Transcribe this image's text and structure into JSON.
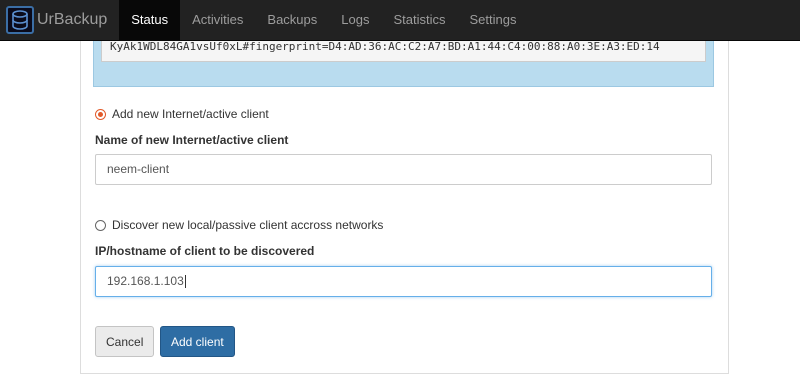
{
  "app": {
    "brand_name": "UrBackup",
    "logo_icon": "database-icon"
  },
  "nav": {
    "items": [
      {
        "label": "Status",
        "active": true
      },
      {
        "label": "Activities",
        "active": false
      },
      {
        "label": "Backups",
        "active": false
      },
      {
        "label": "Logs",
        "active": false
      },
      {
        "label": "Statistics",
        "active": false
      },
      {
        "label": "Settings",
        "active": false
      }
    ]
  },
  "info_box": {
    "code_text": "KyAk1WDL84GA1vsUf0xL#fingerprint=D4:AD:36:AC:C2:A7:BD:A1:44:C4:00:88:A0:3E:A3:ED:14"
  },
  "internet_client": {
    "radio_label": "Add new Internet/active client",
    "selected": true,
    "name_label": "Name of new Internet/active client",
    "name_value": "neem-client"
  },
  "local_client": {
    "radio_label": "Discover new local/passive client accross networks",
    "selected": false,
    "host_label": "IP/hostname of client to be discovered",
    "host_value": "192.168.1.103"
  },
  "actions": {
    "cancel_label": "Cancel",
    "add_label": "Add client"
  },
  "colors": {
    "navbar": "#222222",
    "accent": "#2e6da4",
    "radio_selected": "#e25a2a",
    "info_bg": "#b9dcef"
  }
}
